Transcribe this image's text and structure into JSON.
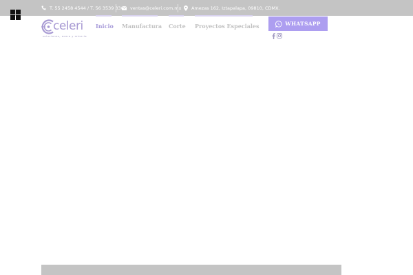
{
  "topbar": {
    "phone_text": "T. 55 2458 4544 / T. 56 3539 3301",
    "email_text": "ventas@celeri.com.mx",
    "address_text": "Amezas 162, Iztapalapa, 09810, CDMX."
  },
  "logo": {
    "name": "celeri",
    "tagline": "soluciones, acero y mineria"
  },
  "nav": {
    "items": [
      {
        "label": "Inicio"
      },
      {
        "label": "Manufactura"
      },
      {
        "label": "Corte"
      },
      {
        "label": "Proyectos Especiales"
      }
    ]
  },
  "whatsapp": {
    "label": "WHATSAPP"
  },
  "colors": {
    "accent": "#ad9ef0",
    "topbar": "#c4c4c4",
    "nav_active": "#a79bd9",
    "nav_inactive": "#c2c2c2"
  }
}
